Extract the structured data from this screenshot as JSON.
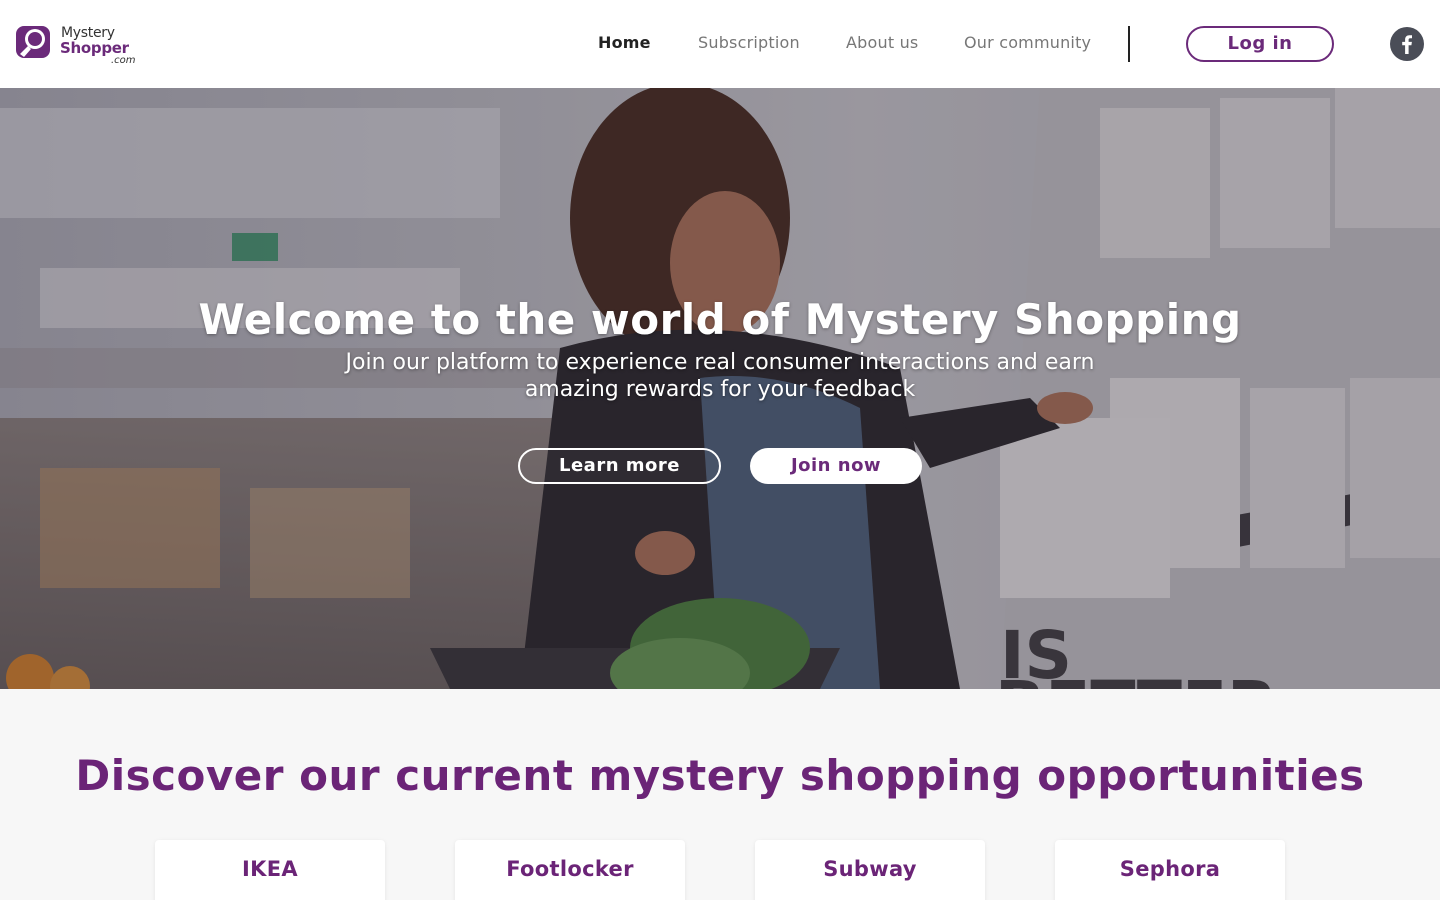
{
  "brand": {
    "name_line1": "Mystery",
    "name_line2": "Shopper",
    "domain_suffix": ".com",
    "primary_color": "#6b2a7a",
    "logo_icon": "speech-bubble-magnifier-icon"
  },
  "nav": {
    "items": [
      {
        "label": "Home",
        "active": true
      },
      {
        "label": "Subscription",
        "active": false
      },
      {
        "label": "About us",
        "active": false
      },
      {
        "label": "Our community",
        "active": false
      }
    ],
    "login_label": "Log in",
    "social_icon": "facebook-icon"
  },
  "hero": {
    "title": "Welcome to the world of Mystery Shopping",
    "subtitle": "Join our platform to experience real consumer interactions and earn amazing rewards for your feedback",
    "learn_more_label": "Learn more",
    "join_now_label": "Join now"
  },
  "opportunities": {
    "title": "Discover our current mystery shopping opportunities",
    "cards": [
      {
        "name": "IKEA"
      },
      {
        "name": "Footlocker"
      },
      {
        "name": "Subway"
      },
      {
        "name": "Sephora"
      }
    ]
  }
}
